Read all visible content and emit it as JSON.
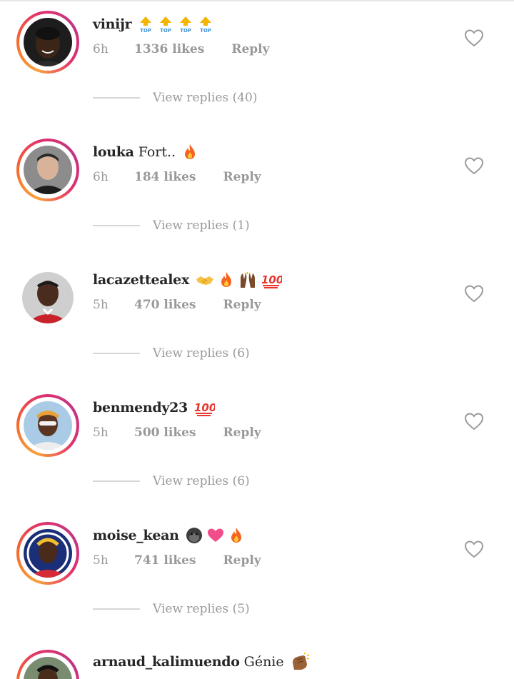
{
  "comments": [
    {
      "username": "vinijr",
      "text": "",
      "emoji_names": [
        "top-arrow-emoji",
        "top-arrow-emoji",
        "top-arrow-emoji",
        "top-arrow-emoji"
      ],
      "emoji_label": "TOP",
      "time": "6h",
      "likes": "1336 likes",
      "reply_label": "Reply",
      "view_replies": "View replies (40)",
      "has_story_ring": true
    },
    {
      "username": "louka",
      "text": "Fort..",
      "emoji_names": [
        "fire-emoji"
      ],
      "time": "6h",
      "likes": "184 likes",
      "reply_label": "Reply",
      "view_replies": "View replies (1)",
      "has_story_ring": true
    },
    {
      "username": "lacazettealex",
      "text": "",
      "emoji_names": [
        "handshake-emoji",
        "fire-emoji",
        "raised-hands-emoji",
        "hundred-emoji"
      ],
      "time": "5h",
      "likes": "470 likes",
      "reply_label": "Reply",
      "view_replies": "View replies (6)",
      "has_story_ring": false
    },
    {
      "username": "benmendy23",
      "text": "",
      "emoji_names": [
        "hundred-emoji"
      ],
      "time": "5h",
      "likes": "500 likes",
      "reply_label": "Reply",
      "view_replies": "View replies (6)",
      "has_story_ring": true
    },
    {
      "username": "moise_kean",
      "text": "",
      "emoji_names": [
        "gorilla-emoji",
        "heart-emoji",
        "fire-emoji"
      ],
      "time": "5h",
      "likes": "741 likes",
      "reply_label": "Reply",
      "view_replies": "View replies (5)",
      "has_story_ring": true
    },
    {
      "username": "arnaud_kalimuendo",
      "text": "Génie",
      "emoji_names": [
        "clapping-hands-emoji"
      ],
      "time": "",
      "likes": "",
      "reply_label": "",
      "view_replies": "",
      "has_story_ring": true
    }
  ],
  "colors": {
    "story_ring_start": "#f9a13b",
    "story_ring_end": "#c13584",
    "muted_text": "#9a9a9a",
    "primary_text": "#262626"
  }
}
